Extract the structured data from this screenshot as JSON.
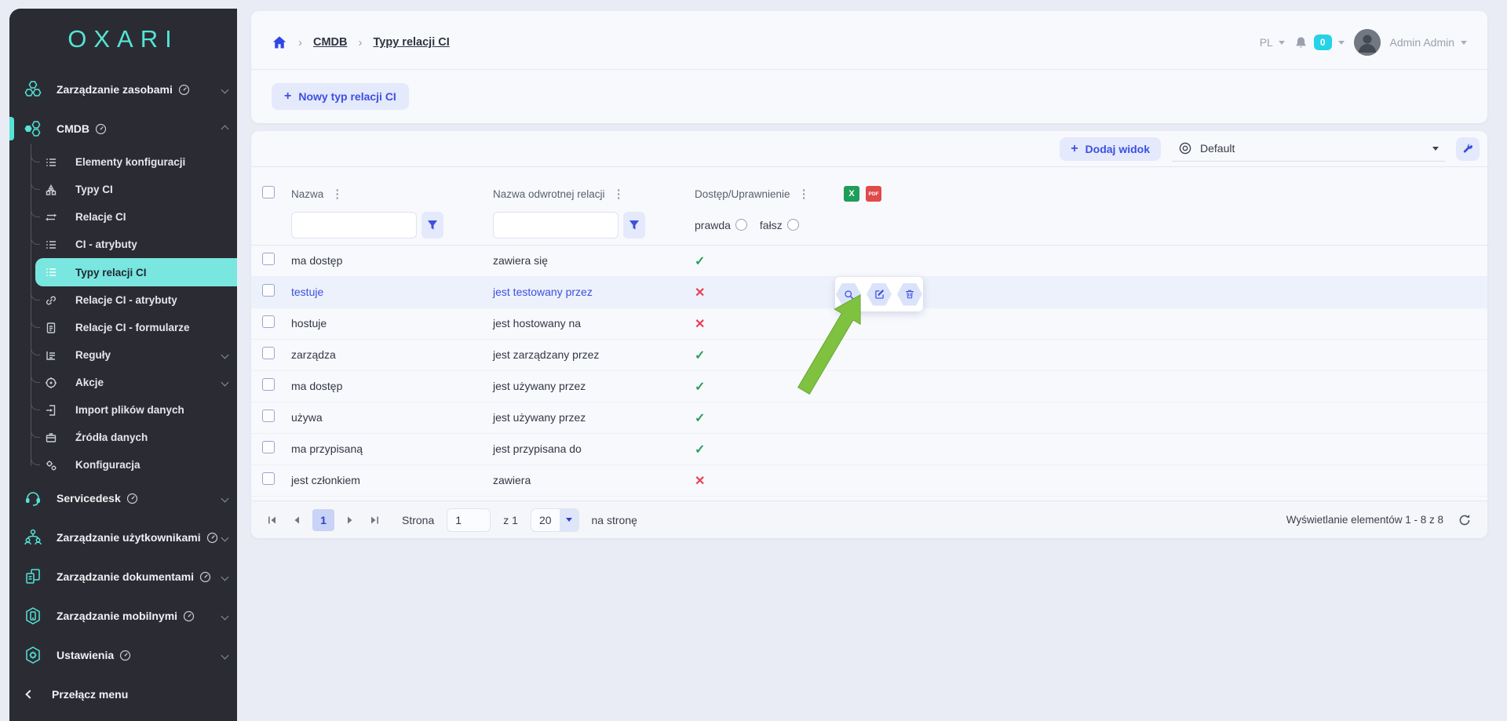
{
  "app": {
    "logo_text": "OXARI"
  },
  "sidebar": {
    "toggle_label": "Przełącz menu",
    "sections": [
      {
        "label": "Zarządzanie zasobami"
      },
      {
        "label": "CMDB"
      },
      {
        "label": "Servicedesk"
      },
      {
        "label": "Zarządzanie użytkownikami"
      },
      {
        "label": "Zarządzanie dokumentami"
      },
      {
        "label": "Zarządzanie mobilnymi"
      },
      {
        "label": "Ustawienia"
      }
    ],
    "cmdb_children": [
      {
        "label": "Elementy konfiguracji"
      },
      {
        "label": "Typy CI"
      },
      {
        "label": "Relacje CI"
      },
      {
        "label": "CI - atrybuty"
      },
      {
        "label": "Typy relacji CI"
      },
      {
        "label": "Relacje CI - atrybuty"
      },
      {
        "label": "Relacje CI - formularze"
      },
      {
        "label": "Reguły"
      },
      {
        "label": "Akcje"
      },
      {
        "label": "Import plików danych"
      },
      {
        "label": "Źródła danych"
      },
      {
        "label": "Konfiguracja"
      }
    ]
  },
  "breadcrumb": {
    "items": [
      {
        "label": "CMDB"
      },
      {
        "label": "Typy relacji CI"
      }
    ]
  },
  "topbar": {
    "language": "PL",
    "notification_count": "0",
    "user_name": "Admin Admin"
  },
  "page_actions": {
    "new_relation_type": "Nowy typ relacji CI"
  },
  "table_toolbar": {
    "add_view": "Dodaj widok",
    "view_name": "Default"
  },
  "table": {
    "columns": [
      {
        "label": "Nazwa"
      },
      {
        "label": "Nazwa odwrotnej relacji"
      },
      {
        "label": "Dostęp/Uprawnienie"
      }
    ],
    "filters": {
      "name_value": "",
      "reverse_value": "",
      "true_label": "prawda",
      "false_label": "fałsz"
    },
    "rows": [
      {
        "name": "ma dostęp",
        "reverse_name": "zawiera się",
        "access_glyph": "✓",
        "access": "granted",
        "variant": "normal"
      },
      {
        "name": "testuje",
        "reverse_name": "jest testowany przez",
        "access_glyph": "✕",
        "access": "denied",
        "variant": "link"
      },
      {
        "name": "hostuje",
        "reverse_name": "jest hostowany na",
        "access_glyph": "✕",
        "access": "denied",
        "variant": "normal"
      },
      {
        "name": "zarządza",
        "reverse_name": "jest zarządzany przez",
        "access_glyph": "✓",
        "access": "granted",
        "variant": "normal"
      },
      {
        "name": "ma dostęp",
        "reverse_name": "jest używany przez",
        "access_glyph": "✓",
        "access": "granted",
        "variant": "normal"
      },
      {
        "name": "używa",
        "reverse_name": "jest używany przez",
        "access_glyph": "✓",
        "access": "granted",
        "variant": "normal"
      },
      {
        "name": "ma przypisaną",
        "reverse_name": "jest przypisana do",
        "access_glyph": "✓",
        "access": "granted",
        "variant": "normal"
      },
      {
        "name": "jest członkiem",
        "reverse_name": "zawiera",
        "access_glyph": "✕",
        "access": "denied",
        "variant": "normal"
      }
    ],
    "export": {
      "excel_glyph": "X",
      "pdf_glyph": "PDF"
    }
  },
  "pagination": {
    "page_label": "Strona",
    "current_page": "1",
    "total_label": "z 1",
    "page_size": "20",
    "per_page_label": "na stronę",
    "summary": "Wyświetlanie elementów 1 - 8 z 8"
  },
  "glyphs": {
    "column_menu": "⋮"
  },
  "colors": {
    "accent_teal": "#54e3d5",
    "accent_blue": "#3d50e0",
    "badge_cyan": "#25d2e6",
    "success_green": "#27a05d",
    "danger_red": "#e84156",
    "arrow_green": "#7fc240"
  }
}
